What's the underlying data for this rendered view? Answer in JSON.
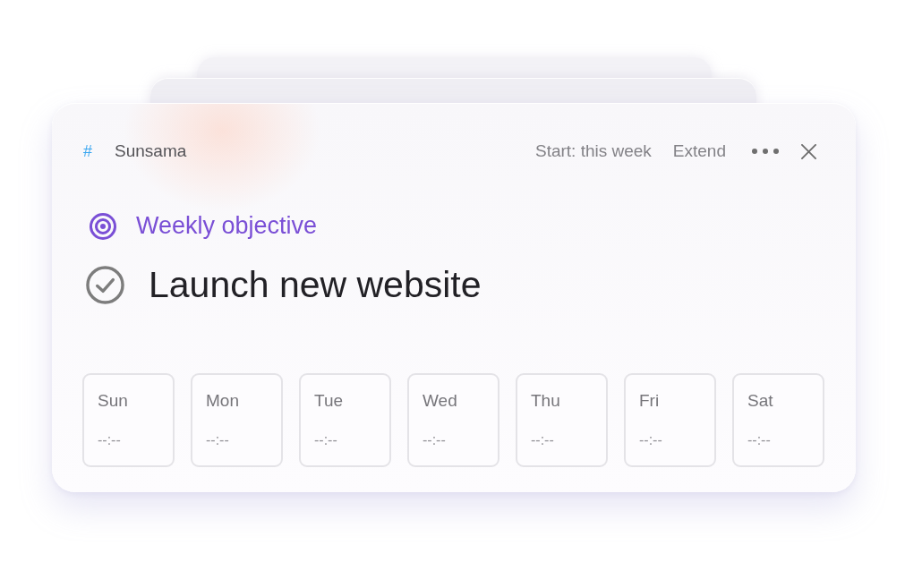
{
  "header": {
    "channel_symbol": "#",
    "channel": "Sunsama",
    "actions": [
      "Start: this week",
      "Extend"
    ]
  },
  "objective": {
    "label": "Weekly objective",
    "title": "Launch new website",
    "done": false
  },
  "days": [
    {
      "label": "Sun",
      "time": "--:--"
    },
    {
      "label": "Mon",
      "time": "--:--"
    },
    {
      "label": "Tue",
      "time": "--:--"
    },
    {
      "label": "Wed",
      "time": "--:--"
    },
    {
      "label": "Thu",
      "time": "--:--"
    },
    {
      "label": "Fri",
      "time": "--:--"
    },
    {
      "label": "Sat",
      "time": "--:--"
    }
  ]
}
